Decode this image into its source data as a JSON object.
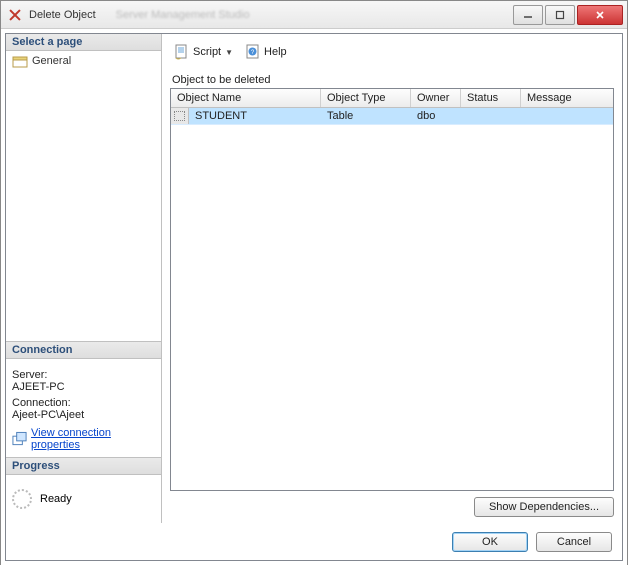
{
  "window": {
    "title": "Delete Object"
  },
  "sidebar": {
    "select_page_header": "Select a page",
    "pages": [
      {
        "label": "General"
      }
    ],
    "connection_header": "Connection",
    "server_label": "Server:",
    "server_value": "AJEET-PC",
    "connection_label": "Connection:",
    "connection_value": "Ajeet-PC\\Ajeet",
    "view_props_link": "View connection properties",
    "progress_header": "Progress",
    "progress_status": "Ready"
  },
  "toolbar": {
    "script_label": "Script",
    "help_label": "Help"
  },
  "grid": {
    "group_label": "Object to be deleted",
    "headers": {
      "object_name": "Object Name",
      "object_type": "Object Type",
      "owner": "Owner",
      "status": "Status",
      "message": "Message"
    },
    "rows": [
      {
        "name": "STUDENT",
        "type": "Table",
        "owner": "dbo",
        "status": "",
        "message": ""
      }
    ]
  },
  "buttons": {
    "show_dependencies": "Show Dependencies...",
    "ok": "OK",
    "cancel": "Cancel"
  }
}
